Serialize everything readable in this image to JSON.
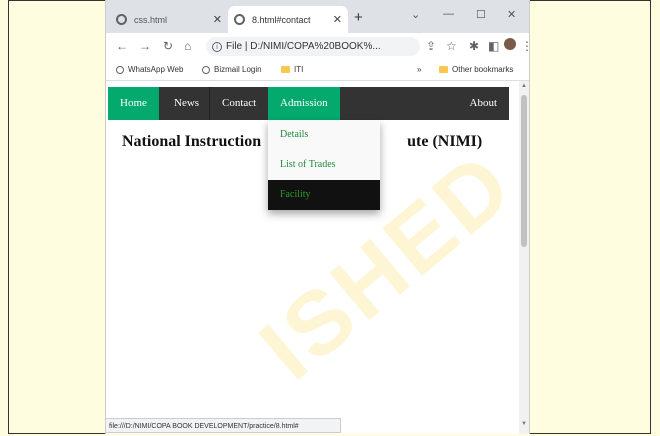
{
  "tabs": [
    {
      "title": "css.html"
    },
    {
      "title": "8.html#contact"
    }
  ],
  "address": "File | D:/NIMI/COPA%20BOOK%...",
  "bookmarks": [
    "WhatsApp Web",
    "Bizmail Login",
    "ITI"
  ],
  "other_bookmarks": "Other bookmarks",
  "nav": {
    "home": "Home",
    "news": "News",
    "contact": "Contact",
    "admission": "Admission",
    "about": "About"
  },
  "dropdown": [
    "Details",
    "List of Trades",
    "Facility"
  ],
  "heading": {
    "left": "National Instruction",
    "right": "ute (NIMI)"
  },
  "status_url": "file:///D:/NIMI/COPA BOOK DEVELOPMENT/practice/8.html#",
  "watermark": "ISHED",
  "colors": {
    "accent": "#04aa6d",
    "navbar": "#333333",
    "background": "#fffde0"
  }
}
